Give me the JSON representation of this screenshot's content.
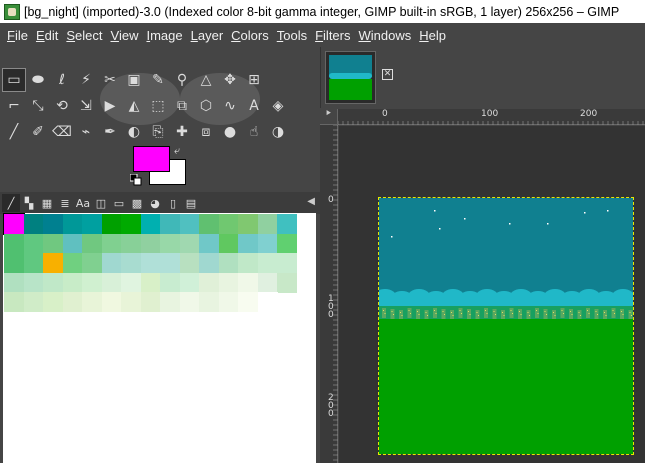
{
  "window": {
    "title": "[bg_night] (imported)-3.0 (Indexed color 8-bit gamma integer, GIMP built-in sRGB, 1 layer) 256x256 – GIMP"
  },
  "menu": [
    "File",
    "Edit",
    "Select",
    "View",
    "Image",
    "Layer",
    "Colors",
    "Tools",
    "Filters",
    "Windows",
    "Help"
  ],
  "tools": [
    [
      {
        "name": "rect-select-tool-icon",
        "glyph": "▭",
        "selected": true
      },
      {
        "name": "ellipse-select-tool-icon",
        "glyph": "⬬"
      },
      {
        "name": "free-select-tool-icon",
        "glyph": "ℓ"
      },
      {
        "name": "fuzzy-select-tool-icon",
        "glyph": "⚡"
      },
      {
        "name": "scissors-select-tool-icon",
        "glyph": "✂"
      },
      {
        "name": "foreground-select-tool-icon",
        "glyph": "▣"
      },
      {
        "name": "color-picker-tool-icon",
        "glyph": "✎"
      },
      {
        "name": "zoom-tool-icon",
        "glyph": "⚲"
      },
      {
        "name": "measure-tool-icon",
        "glyph": "△"
      },
      {
        "name": "move-tool-icon",
        "glyph": "✥"
      },
      {
        "name": "align-tool-icon",
        "glyph": "⊞"
      }
    ],
    [
      {
        "name": "crop-tool-icon",
        "glyph": "⌐"
      },
      {
        "name": "unified-transform-tool-icon",
        "glyph": "⤡"
      },
      {
        "name": "rotate-tool-icon",
        "glyph": "⟲"
      },
      {
        "name": "scale-tool-icon",
        "glyph": "⇲"
      },
      {
        "name": "shear-tool-icon",
        "glyph": "▶"
      },
      {
        "name": "flip-tool-icon",
        "glyph": "◭"
      },
      {
        "name": "perspective-tool-icon",
        "glyph": "⬚"
      },
      {
        "name": "handle-transform-tool-icon",
        "glyph": "⧉"
      },
      {
        "name": "cage-transform-tool-icon",
        "glyph": "⬡"
      },
      {
        "name": "warp-transform-tool-icon",
        "glyph": "∿"
      },
      {
        "name": "text-tool-icon",
        "glyph": "A"
      },
      {
        "name": "bucket-fill-tool-icon",
        "glyph": "◈"
      }
    ],
    [
      {
        "name": "paintbrush-tool-icon",
        "glyph": "╱"
      },
      {
        "name": "pencil-tool-icon",
        "glyph": "✐"
      },
      {
        "name": "eraser-tool-icon",
        "glyph": "⌫"
      },
      {
        "name": "airbrush-tool-icon",
        "glyph": "⌁"
      },
      {
        "name": "ink-tool-icon",
        "glyph": "✒"
      },
      {
        "name": "mypaint-brush-tool-icon",
        "glyph": "◐"
      },
      {
        "name": "clone-tool-icon",
        "glyph": "⎘"
      },
      {
        "name": "heal-tool-icon",
        "glyph": "✚"
      },
      {
        "name": "perspective-clone-tool-icon",
        "glyph": "⧈"
      },
      {
        "name": "blur-tool-icon",
        "glyph": "●"
      },
      {
        "name": "smudge-tool-icon",
        "glyph": "☝"
      },
      {
        "name": "dodge-burn-tool-icon",
        "glyph": "◑"
      }
    ]
  ],
  "colors": {
    "foreground": "#ff00ff",
    "background": "#ffffff"
  },
  "dock_tabs": [
    {
      "name": "brushes-tab-icon",
      "glyph": "╱",
      "active": true
    },
    {
      "name": "patterns-tab-icon",
      "glyph": "▚"
    },
    {
      "name": "gradients-tab-icon",
      "glyph": "▦"
    },
    {
      "name": "fonts-tab-icon",
      "glyph": "≣"
    },
    {
      "name": "font-tab-icon",
      "glyph": "Aa"
    },
    {
      "name": "document-history-tab-icon",
      "glyph": "◫"
    },
    {
      "name": "templates-tab-icon",
      "glyph": "▭"
    },
    {
      "name": "colormap-tab-icon",
      "glyph": "▩"
    },
    {
      "name": "palette-tab-icon",
      "glyph": "◕"
    },
    {
      "name": "documents-tab-icon",
      "glyph": "▯"
    },
    {
      "name": "images-tab-icon",
      "glyph": "▤"
    }
  ],
  "palette": [
    [
      "#ff00ff",
      "#008080",
      "#008090",
      "#009898",
      "#00a0a0",
      "#00a000",
      "#00aa00",
      "#00b0b0",
      "#40b8b8",
      "#50c0c0",
      "#60c070",
      "#70c870",
      "#80c870",
      "#90d0a0",
      "#40c0c0"
    ],
    [
      "#50c070",
      "#60c880",
      "#70c880",
      "#60c0c0",
      "#70c880",
      "#80d090",
      "#88d098",
      "#90d0a0",
      "#98d8a8",
      "#a0d8b0",
      "#70c8c8",
      "#60c860",
      "#70c8c8",
      "#80d0d0",
      "#60d070"
    ],
    [
      "#50c070",
      "#60c880",
      "#f8b000",
      "#70d080",
      "#80d090",
      "#a0d8d0",
      "#a8dcd0",
      "#b0e0d8",
      "#b0e0d8",
      "#b8e0c0",
      "#a0d8d0",
      "#b0e0c0",
      "#c0e8c8",
      "#c8ecd0",
      "#c8ecd0"
    ],
    [
      "#b0e0c0",
      "#b8e4c8",
      "#c0e8c8",
      "#c8ecc8",
      "#d0f0d0",
      "#d8f0d8",
      "#e0f4e0",
      "#d8f0c8",
      "#c8ecd0",
      "#d0f0d8",
      "#e0f0d8",
      "#e8f4e0",
      "#f0f8e8",
      "#e0f0e0",
      "#c8e8c8"
    ],
    [
      "#c8e8c0",
      "#d0ecc8",
      "#d8f0c8",
      "#e0f0d0",
      "#e8f4d8",
      "#f0f8e0",
      "#e8f4d8",
      "#e0f0d0",
      "#e8f4e0",
      "#f0f8e8",
      "#e8f4e0",
      "#f0f8e8",
      "#f8fcf0",
      "#ffffff",
      "#ffffff"
    ]
  ],
  "palette_row_lengths": [
    15,
    15,
    15,
    15,
    14
  ],
  "rulers": {
    "horizontal": [
      "0",
      "100",
      "200"
    ],
    "vertical": [
      "0",
      "100",
      "200"
    ]
  },
  "image_tab": {
    "close_glyph": "✕"
  },
  "corner_glyph": "⯈",
  "canvas_colors": {
    "sky": "#108090",
    "cloud": "#20b8c8",
    "city": "#18a060",
    "ground": "#00a000",
    "stars": "#ffffff",
    "windows": "#e0e060"
  }
}
